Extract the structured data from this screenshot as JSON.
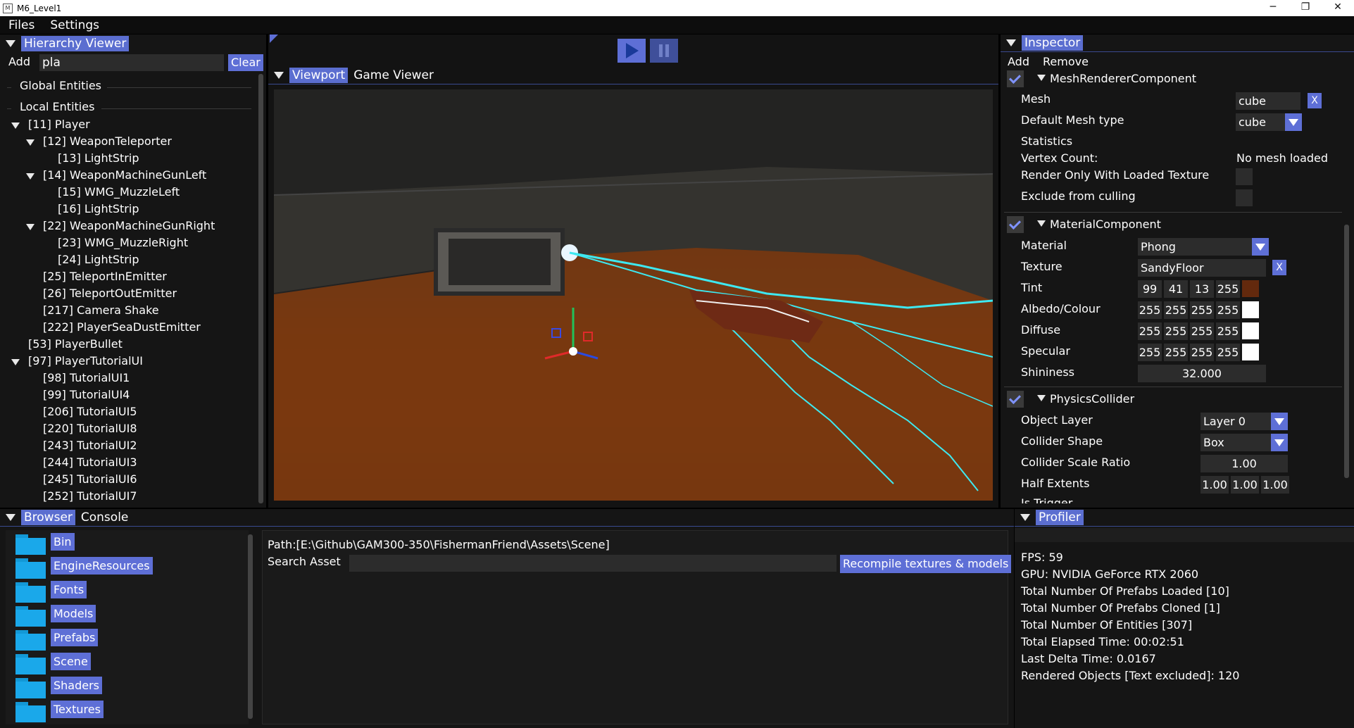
{
  "window": {
    "title": "M6_Level1",
    "minimize": "─",
    "maximize": "❐",
    "close": "✕"
  },
  "menu": [
    "Files",
    "Settings"
  ],
  "hierarchy": {
    "title": "Hierarchy Viewer",
    "add": "Add",
    "search": "pla",
    "clear": "Clear",
    "global": "Global Entities",
    "local": "Local Entities",
    "items": [
      {
        "label": "[11] Player",
        "depth": 0,
        "arrow": true
      },
      {
        "label": "[12] WeaponTeleporter",
        "depth": 1,
        "arrow": true
      },
      {
        "label": "[13] LightStrip",
        "depth": 2,
        "arrow": false
      },
      {
        "label": "[14] WeaponMachineGunLeft",
        "depth": 1,
        "arrow": true
      },
      {
        "label": "[15] WMG_MuzzleLeft",
        "depth": 2,
        "arrow": false
      },
      {
        "label": "[16] LightStrip",
        "depth": 2,
        "arrow": false
      },
      {
        "label": "[22] WeaponMachineGunRight",
        "depth": 1,
        "arrow": true
      },
      {
        "label": "[23] WMG_MuzzleRight",
        "depth": 2,
        "arrow": false
      },
      {
        "label": "[24] LightStrip",
        "depth": 2,
        "arrow": false
      },
      {
        "label": "[25] TeleportInEmitter",
        "depth": 1,
        "arrow": false
      },
      {
        "label": "[26] TeleportOutEmitter",
        "depth": 1,
        "arrow": false
      },
      {
        "label": "[217] Camera Shake",
        "depth": 1,
        "arrow": false
      },
      {
        "label": "[222] PlayerSeaDustEmitter",
        "depth": 1,
        "arrow": false
      },
      {
        "label": "[53] PlayerBullet",
        "depth": 0,
        "arrow": false
      },
      {
        "label": "[97] PlayerTutorialUI",
        "depth": 0,
        "arrow": true
      },
      {
        "label": "[98] TutorialUI1",
        "depth": 1,
        "arrow": false
      },
      {
        "label": "[99] TutorialUI4",
        "depth": 1,
        "arrow": false
      },
      {
        "label": "[206] TutorialUI5",
        "depth": 1,
        "arrow": false
      },
      {
        "label": "[220] TutorialUI8",
        "depth": 1,
        "arrow": false
      },
      {
        "label": "[243] TutorialUI2",
        "depth": 1,
        "arrow": false
      },
      {
        "label": "[244] TutorialUI3",
        "depth": 1,
        "arrow": false
      },
      {
        "label": "[245] TutorialUI6",
        "depth": 1,
        "arrow": false
      },
      {
        "label": "[252] TutorialUI7",
        "depth": 1,
        "arrow": false
      }
    ]
  },
  "viewport": {
    "tabs": [
      "Viewport",
      "Game Viewer"
    ],
    "play": "play-icon",
    "pause": "pause-icon"
  },
  "inspector": {
    "title": "Inspector",
    "add": "Add",
    "remove": "Remove",
    "mesh": {
      "name": "MeshRendererComponent",
      "mesh_label": "Mesh",
      "mesh_value": "cube",
      "default_label": "Default Mesh type",
      "default_value": "cube",
      "stats": "Statistics",
      "vertex_label": "Vertex Count:",
      "vertex_value": "No mesh loaded",
      "render_only": "Render Only With Loaded Texture",
      "exclude": "Exclude from culling",
      "x": "X"
    },
    "material": {
      "name": "MaterialComponent",
      "material_label": "Material",
      "material_value": "Phong",
      "texture_label": "Texture",
      "texture_value": "SandyFloor",
      "x": "X",
      "rows": [
        {
          "label": "Tint",
          "values": [
            "99",
            "41",
            "13",
            "255"
          ],
          "swatch": "#63290d"
        },
        {
          "label": "Albedo/Colour",
          "values": [
            "255",
            "255",
            "255",
            "255"
          ],
          "swatch": "#ffffff"
        },
        {
          "label": "Diffuse",
          "values": [
            "255",
            "255",
            "255",
            "255"
          ],
          "swatch": "#ffffff"
        },
        {
          "label": "Specular",
          "values": [
            "255",
            "255",
            "255",
            "255"
          ],
          "swatch": "#ffffff"
        }
      ],
      "shininess_label": "Shininess",
      "shininess_value": "32.000"
    },
    "physics": {
      "name": "PhysicsCollider",
      "layer_label": "Object Layer",
      "layer_value": "Layer 0",
      "shape_label": "Collider Shape",
      "shape_value": "Box",
      "scale_label": "Collider Scale Ratio",
      "scale_value": "1.00",
      "half_label": "Half Extents",
      "half_values": [
        "1.00",
        "1.00",
        "1.00"
      ],
      "trigger_label": "Is Trigger"
    }
  },
  "browser": {
    "tabs": [
      "Browser",
      "Console"
    ],
    "folders": [
      "Bin",
      "EngineResources",
      "Fonts",
      "Models",
      "Prefabs",
      "Scene",
      "Shaders",
      "Textures"
    ],
    "path": "Path:[E:\\Github\\GAM300-350\\FishermanFriend\\Assets\\Scene]",
    "search_label": "Search Asset",
    "search_value": "",
    "recompile": "Recompile textures & models"
  },
  "profiler": {
    "title": "Profiler",
    "lines": [
      "FPS: 59",
      "GPU: NVIDIA GeForce RTX 2060",
      "Total Number Of Prefabs Loaded [10]",
      "Total Number Of Prefabs Cloned [1]",
      "Total Number Of Entities [307]",
      "Total Elapsed Time: 00:02:51",
      "Last Delta Time: 0.0167",
      "Rendered Objects [Text excluded]: 120"
    ]
  },
  "colors": {
    "accent": "#5e6fd6",
    "panel": "#151515",
    "field": "#2c2c2c",
    "lightning": "#3ee8f0",
    "floor": "#7a3a10"
  }
}
